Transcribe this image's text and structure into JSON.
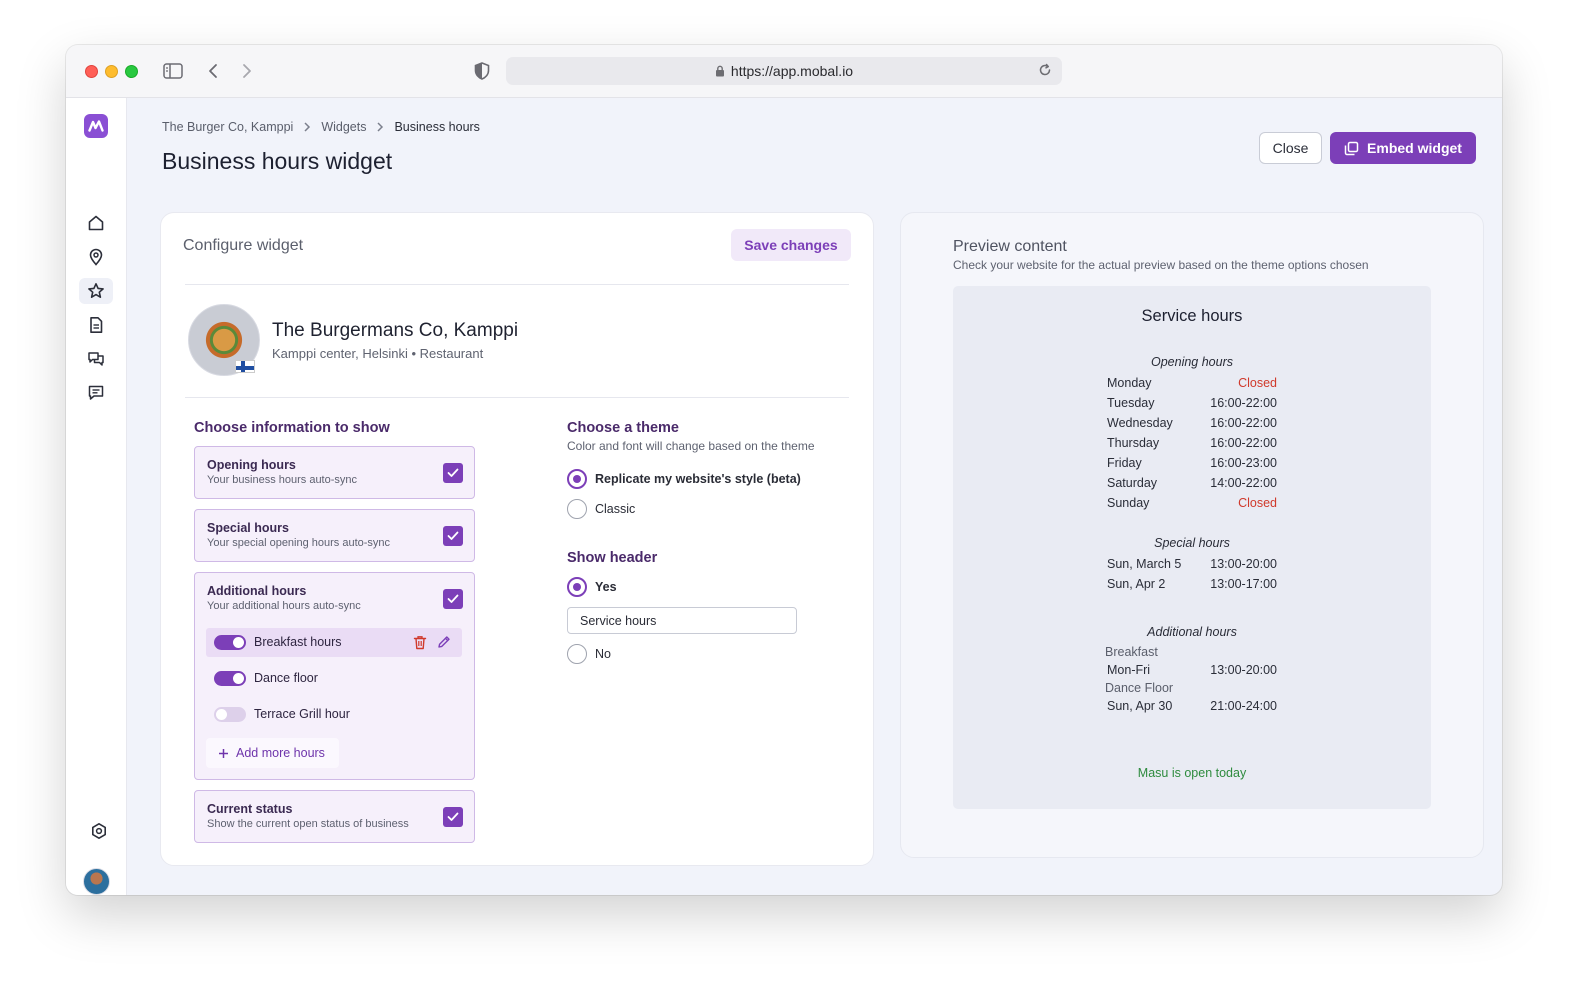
{
  "browser": {
    "url": "https://app.mobal.io"
  },
  "breadcrumb": {
    "items": [
      "The Burger Co, Kamppi",
      "Widgets",
      "Business hours"
    ]
  },
  "page": {
    "title": "Business hours widget",
    "close_label": "Close",
    "embed_label": "Embed widget"
  },
  "config": {
    "title": "Configure widget",
    "save_label": "Save changes",
    "business": {
      "name": "The Burgermans Co, Kamppi",
      "meta": "Kamppi center, Helsinki • Restaurant"
    },
    "info_section_title": "Choose information to show",
    "options": [
      {
        "title": "Opening hours",
        "subtitle": "Your business hours auto-sync",
        "checked": true
      },
      {
        "title": "Special hours",
        "subtitle": "Your special opening hours auto-sync",
        "checked": true
      },
      {
        "title": "Additional hours",
        "subtitle": "Your additional hours auto-sync",
        "checked": true
      },
      {
        "title": "Current status",
        "subtitle": "Show the current open status of business",
        "checked": true
      }
    ],
    "additional_items": [
      {
        "label": "Breakfast hours",
        "enabled": true
      },
      {
        "label": "Dance floor",
        "enabled": true
      },
      {
        "label": "Terrace Grill hour",
        "enabled": false
      }
    ],
    "add_more_label": "Add more hours",
    "theme": {
      "title": "Choose a theme",
      "subtitle": "Color and font will change based on the theme",
      "options": [
        {
          "label": "Replicate my website's style (beta)",
          "selected": true
        },
        {
          "label": "Classic",
          "selected": false
        }
      ]
    },
    "header": {
      "title": "Show header",
      "yes_label": "Yes",
      "no_label": "No",
      "selected": "Yes",
      "input_value": "Service hours"
    }
  },
  "preview": {
    "title": "Preview content",
    "subtitle": "Check your website for the actual preview based on the theme options chosen",
    "widget": {
      "heading": "Service hours",
      "opening_title": "Opening hours",
      "opening": [
        {
          "day": "Monday",
          "time": "Closed",
          "closed": true
        },
        {
          "day": "Tuesday",
          "time": "16:00-22:00",
          "closed": false
        },
        {
          "day": "Wednesday",
          "time": "16:00-22:00",
          "closed": false
        },
        {
          "day": "Thursday",
          "time": "16:00-22:00",
          "closed": false
        },
        {
          "day": "Friday",
          "time": "16:00-23:00",
          "closed": false
        },
        {
          "day": "Saturday",
          "time": "14:00-22:00",
          "closed": false
        },
        {
          "day": "Sunday",
          "time": "Closed",
          "closed": true
        }
      ],
      "special_title": "Special hours",
      "special": [
        {
          "day": "Sun, March 5",
          "time": "13:00-20:00"
        },
        {
          "day": "Sun, Apr 2",
          "time": "13:00-17:00"
        }
      ],
      "additional_title": "Additional hours",
      "additional": [
        {
          "name": "Breakfast",
          "day": "Mon-Fri",
          "time": "13:00-20:00"
        },
        {
          "name": "Dance Floor",
          "day": "Sun, Apr 30",
          "time": "21:00-24:00"
        }
      ],
      "status": "Masu is open today"
    }
  },
  "colors": {
    "accent": "#7c3fb8",
    "closed": "#d0392b",
    "open_status": "#2e8b3e"
  }
}
